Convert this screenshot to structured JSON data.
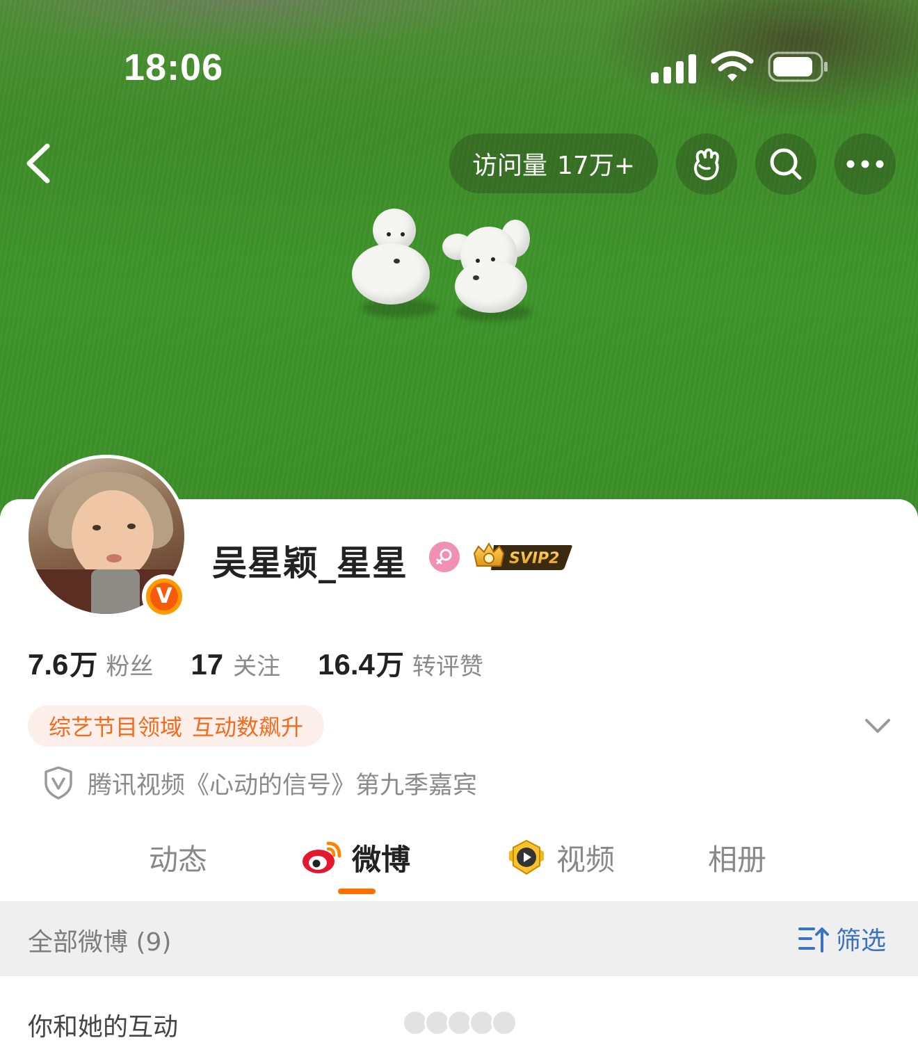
{
  "status_bar": {
    "time": "18:06",
    "signal_icon": "cellular-signal-icon",
    "wifi_icon": "wifi-icon",
    "battery_icon": "battery-icon"
  },
  "header": {
    "back_icon": "chevron-left-icon",
    "visits_label": "访问量",
    "visits_value": "17万+",
    "actions": [
      {
        "icon": "fist-bump-icon"
      },
      {
        "icon": "search-icon"
      },
      {
        "icon": "more-dots-icon"
      }
    ]
  },
  "profile": {
    "username": "吴星颖_星星",
    "gender_icon": "female-icon",
    "vip_badge": "SVIP2",
    "verified_icon": "verified-v-badge-icon",
    "stats": [
      {
        "number": "7.6",
        "unit": "万",
        "label": "粉丝"
      },
      {
        "number": "17",
        "unit": "",
        "label": "关注"
      },
      {
        "number": "16.4",
        "unit": "万",
        "label": "转评赞"
      }
    ],
    "tag": {
      "domain": "综艺节目领域",
      "trend": "互动数飙升"
    },
    "certification": "腾讯视频《心动的信号》第九季嘉宾"
  },
  "tabs": [
    {
      "label": "动态",
      "active": false
    },
    {
      "label": "微博",
      "active": true,
      "icon": "weibo-logo-icon"
    },
    {
      "label": "视频",
      "active": false,
      "icon": "video-play-badge-icon"
    },
    {
      "label": "相册",
      "active": false
    }
  ],
  "feed": {
    "all_label": "全部微博 (9)",
    "filter_label": "筛选",
    "interaction_label": "你和她的互动"
  },
  "colors": {
    "accent_orange": "#ff6f00",
    "tag_text": "#f56a1c",
    "tag_bg": "#fdf0ea",
    "filter_blue": "#3b72c4",
    "grass": "#3e952b"
  }
}
